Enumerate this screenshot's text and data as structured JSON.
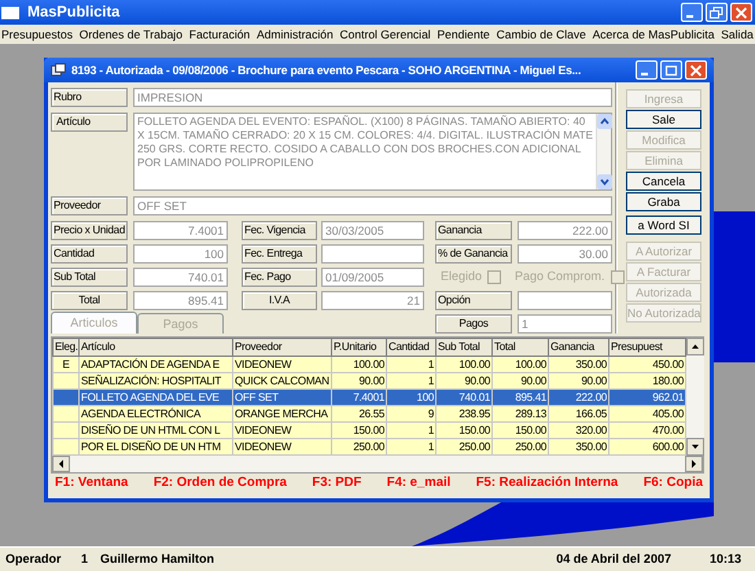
{
  "app": {
    "title": "MasPublicita"
  },
  "menu": [
    "Presupuestos",
    "Ordenes de Trabajo",
    "Facturación",
    "Administración",
    "Control Gerencial",
    "Pendiente",
    "Cambio de Clave",
    "Acerca de MasPublicita",
    "Salida"
  ],
  "child_window": {
    "title": "8193 - Autorizada  - 09/08/2006 - Brochure para evento Pescara - SOHO ARGENTINA - Miguel Es..."
  },
  "rubro": {
    "label": "Rubro",
    "value": "IMPRESION"
  },
  "articulo": {
    "label": "Artículo",
    "value": "FOLLETO AGENDA DEL EVENTO: ESPAÑOL. (X100)  8 PÁGINAS. TAMAÑO ABIERTO: 40 X 15CM. TAMAÑO CERRADO: 20 X 15 CM. COLORES: 4/4. DIGITAL. ILUSTRACIÓN MATE 250 GRS. CORTE RECTO. COSIDO A CABALLO CON DOS BROCHES.CON ADICIONAL POR LAMINADO POLIPROPILENO"
  },
  "proveedor": {
    "label": "Proveedor",
    "value": "OFF SET"
  },
  "column_1": [
    {
      "kind": "number",
      "label": "Precio x Unidad",
      "value": "7.4001"
    },
    {
      "kind": "number",
      "label": "Cantidad",
      "value": "100"
    },
    {
      "kind": "number",
      "label": "Sub Total",
      "value": "740.01"
    },
    {
      "kind": "number",
      "label": "Total",
      "value": "895.41"
    }
  ],
  "column_2": [
    {
      "kind": "text",
      "label": "Fec. Vigencia",
      "value": "30/03/2005"
    },
    {
      "kind": "text",
      "label": "Fec. Entrega"
    },
    {
      "kind": "text",
      "label": "Fec. Pago",
      "value": "01/09/2005"
    },
    {
      "kind": "number",
      "label": "I.V.A",
      "value": "21"
    }
  ],
  "column_3": [
    {
      "kind": "number",
      "label": "Ganancia",
      "value": "222.00"
    },
    {
      "kind": "number",
      "label": "% de Ganancia",
      "value": "30.00"
    },
    {
      "kind": "checks",
      "checks": [
        {
          "label": "Elegido",
          "checked": false,
          "disabled": true
        },
        {
          "label": "Pago Comprom.",
          "checked": false,
          "disabled": true
        }
      ]
    },
    {
      "kind": "text",
      "label": "Opción"
    },
    {
      "kind": "text",
      "label": "Pagos",
      "value": "1"
    }
  ],
  "button_groups": [
    [
      {
        "label": "Ingresa",
        "disabled": true
      },
      {
        "label": "Sale",
        "disabled": false
      },
      {
        "label": "Modifica",
        "disabled": true
      },
      {
        "label": "Elimina",
        "disabled": true
      },
      {
        "label": "Cancela",
        "disabled": false
      },
      {
        "label": "Graba",
        "disabled": false
      }
    ],
    [
      {
        "label": "a Word SI",
        "disabled": false
      }
    ],
    [
      {
        "label": "A  Autorizar",
        "disabled": true
      },
      {
        "label": "A Facturar",
        "disabled": true
      },
      {
        "label": "Autorizada",
        "disabled": true
      },
      {
        "label": "No  Autorizada",
        "disabled": true
      }
    ]
  ],
  "tabs": [
    {
      "label": "Articulos",
      "selected": true
    },
    {
      "label": "Pagos",
      "selected": false
    }
  ],
  "table": {
    "columns": [
      "Eleg.",
      "Artículo",
      "Proveedor",
      "P.Unitario",
      "Cantidad",
      "Sub Total",
      "Total",
      "Ganancia",
      "Presupuest"
    ],
    "rows": [
      {
        "selected": false,
        "cells": [
          "E",
          "ADAPTACIÓN DE AGENDA E",
          "VIDEONEW",
          "100.00",
          "1",
          "100.00",
          "100.00",
          "350.00",
          "450.00"
        ]
      },
      {
        "selected": false,
        "cells": [
          "",
          "SEÑALIZACIÓN: HOSPITALIT",
          "QUICK CALCOMAN",
          "90.00",
          "1",
          "90.00",
          "90.00",
          "90.00",
          "180.00"
        ]
      },
      {
        "selected": true,
        "cells": [
          "",
          "FOLLETO AGENDA DEL EVE",
          "OFF SET",
          "7.4001",
          "100",
          "740.01",
          "895.41",
          "222.00",
          "962.01"
        ]
      },
      {
        "selected": false,
        "cells": [
          "",
          "AGENDA ELECTRÓNICA",
          "ORANGE MERCHA",
          "26.55",
          "9",
          "238.95",
          "289.13",
          "166.05",
          "405.00"
        ]
      },
      {
        "selected": false,
        "cells": [
          "",
          "DISEÑO DE UN HTML CON L",
          "VIDEONEW",
          "150.00",
          "1",
          "150.00",
          "150.00",
          "320.00",
          "470.00"
        ]
      },
      {
        "selected": false,
        "cells": [
          "",
          "POR EL DISEÑO DE UN HTM",
          "VIDEONEW",
          "250.00",
          "1",
          "250.00",
          "250.00",
          "350.00",
          "600.00"
        ]
      }
    ]
  },
  "function_keys": [
    "F1: Ventana",
    "F2: Orden de Compra",
    "F3: PDF",
    "F4: e_mail",
    "F5: Realización Interna",
    "F6: Copia"
  ],
  "status_bar": {
    "label": "Operador",
    "operator_id": "1",
    "operator_name": "Guillermo Hamilton",
    "date": "04 de Abril del 2007",
    "time": "10:13"
  }
}
